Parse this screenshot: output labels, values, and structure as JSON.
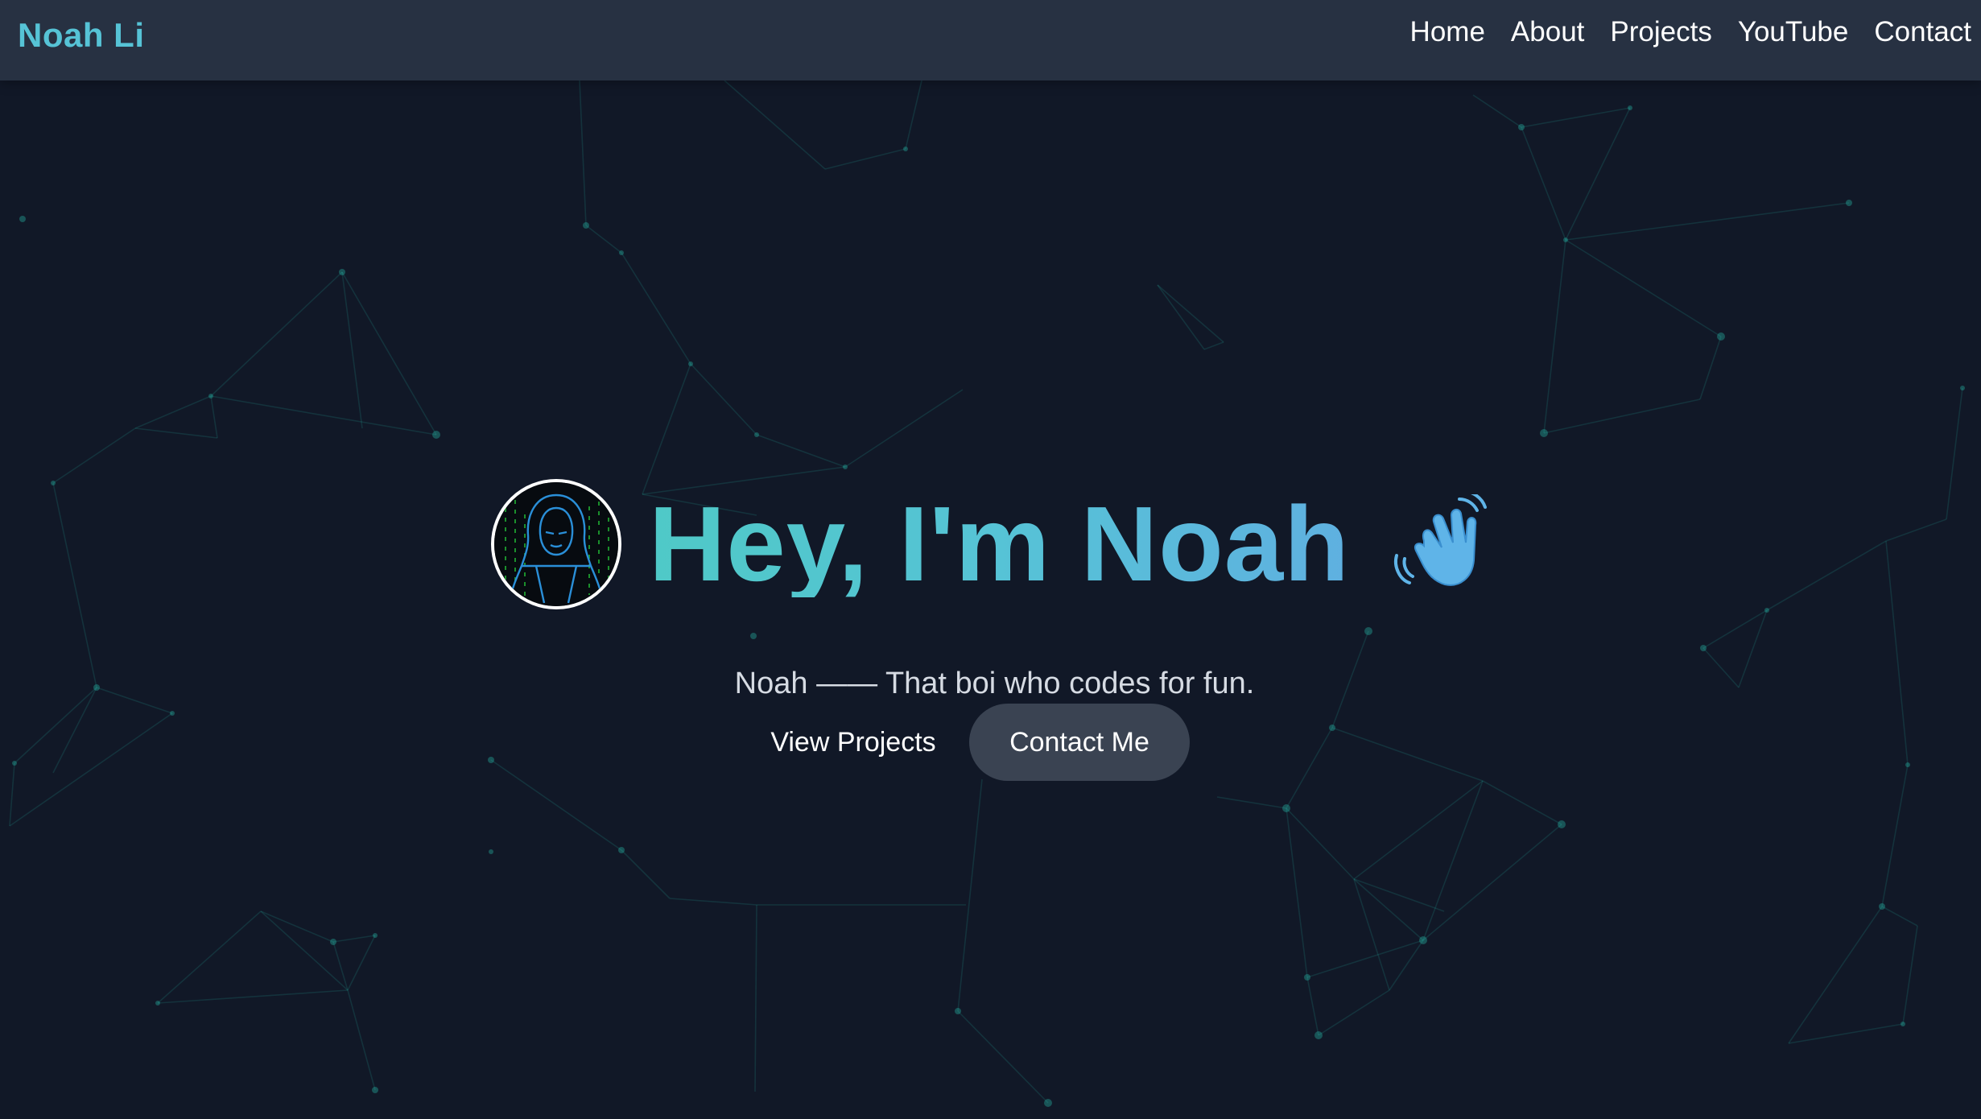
{
  "navbar": {
    "brand": "Noah Li",
    "links": [
      "Home",
      "About",
      "Projects",
      "YouTube",
      "Contact"
    ]
  },
  "hero": {
    "avatar_icon": "hooded-hacker-avatar",
    "title": "Hey, I'm Noah",
    "wave_icon": "waving-hand-icon",
    "subtitle": "Noah —— That boi who codes for fun.",
    "buttons": {
      "view_projects": "View Projects",
      "contact_me": "Contact Me"
    }
  },
  "colors": {
    "background": "#111827",
    "navbar": "#273142",
    "accent": "#56c3d6",
    "network": "#2dd4bf",
    "button_filled": "#3a4352"
  }
}
